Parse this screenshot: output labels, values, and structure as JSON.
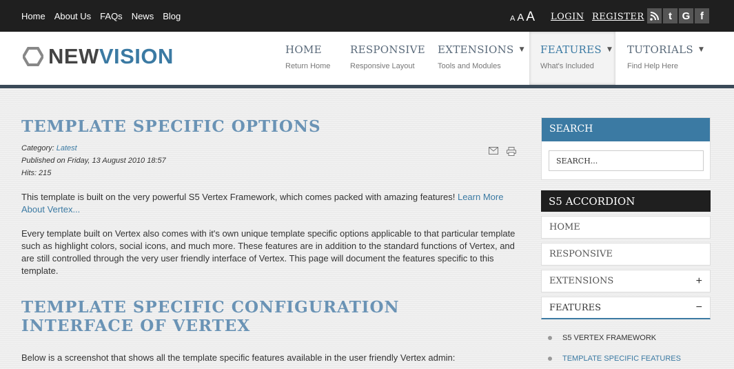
{
  "topbar": {
    "links": [
      "Home",
      "About Us",
      "FAQs",
      "News",
      "Blog"
    ],
    "font_sizes": [
      "A",
      "A",
      "A"
    ],
    "login": "LOGIN",
    "register": "REGISTER",
    "social": [
      "rss-icon",
      "tumblr-icon",
      "google-icon",
      "facebook-icon"
    ]
  },
  "logo": {
    "part1": "NEW",
    "part2": "VISION"
  },
  "menu": [
    {
      "title": "HOME",
      "sub": "Return Home"
    },
    {
      "title": "RESPONSIVE",
      "sub": "Responsive Layout"
    },
    {
      "title": "EXTENSIONS",
      "sub": "Tools and Modules"
    },
    {
      "title": "FEATURES",
      "sub": "What's Included"
    },
    {
      "title": "TUTORIALS",
      "sub": "Find Help Here"
    }
  ],
  "article": {
    "title": "TEMPLATE SPECIFIC OPTIONS",
    "category_label": "Category:",
    "category": "Latest",
    "published": "Published on Friday, 13 August 2010 18:57",
    "hits": "Hits: 215",
    "para1": "This template is built on the very powerful S5 Vertex Framework, which comes packed with amazing features!",
    "para1_link": "Learn More About Vertex...",
    "para2": "Every template built on Vertex also comes with it's own unique template specific options applicable to that particular template such as highlight colors, social icons, and much more. These features are in addition to the standard functions of Vertex, and are still controlled through the very user friendly interface of Vertex. This page will document the features specific to this template.",
    "subtitle": "TEMPLATE SPECIFIC CONFIGURATION INTERFACE OF VERTEX",
    "para3": "Below is a screenshot that shows all the template specific features available in the user friendly Vertex admin:"
  },
  "sidebar": {
    "search_title": "SEARCH",
    "search_value": "SEARCH...",
    "accordion_title": "S5 ACCORDION",
    "accordion_items": [
      {
        "label": "HOME",
        "toggle": ""
      },
      {
        "label": "RESPONSIVE",
        "toggle": ""
      },
      {
        "label": "EXTENSIONS",
        "toggle": "+"
      },
      {
        "label": "FEATURES",
        "toggle": "−"
      }
    ],
    "features_sub": [
      "S5 VERTEX FRAMEWORK",
      "TEMPLATE SPECIFIC FEATURES"
    ]
  },
  "colors": {
    "accent": "#3b7aa3",
    "dark": "#1f1f1f",
    "title": "#6a93b5"
  }
}
